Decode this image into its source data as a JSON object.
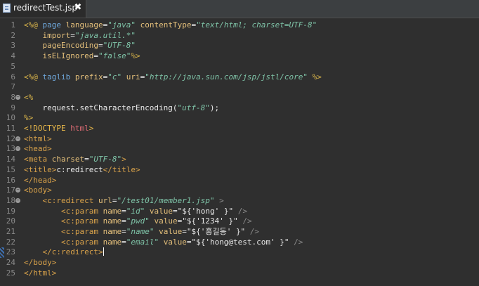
{
  "tab": {
    "title": "redirectTest.jsp",
    "close_glyph": "✖",
    "icon": "jsp-file-icon"
  },
  "gutter": {
    "fold_glyph": "⊖"
  },
  "lines": [
    {
      "n": "1",
      "fold": false,
      "tokens": [
        {
          "t": "<%@ ",
          "c": "t-dir"
        },
        {
          "t": "page ",
          "c": "t-kw"
        },
        {
          "t": "language",
          "c": "t-attr"
        },
        {
          "t": "=",
          "c": "t-plain"
        },
        {
          "t": "\"java\"",
          "c": "t-str"
        },
        {
          "t": " contentType",
          "c": "t-attr"
        },
        {
          "t": "=",
          "c": "t-plain"
        },
        {
          "t": "\"text/html; charset=UTF-8\"",
          "c": "t-str"
        }
      ]
    },
    {
      "n": "2",
      "fold": false,
      "tokens": [
        {
          "t": "    import",
          "c": "t-attr"
        },
        {
          "t": "=",
          "c": "t-plain"
        },
        {
          "t": "\"java.util.*\"",
          "c": "t-str"
        }
      ]
    },
    {
      "n": "3",
      "fold": false,
      "tokens": [
        {
          "t": "    pageEncoding",
          "c": "t-attr"
        },
        {
          "t": "=",
          "c": "t-plain"
        },
        {
          "t": "\"UTF-8\"",
          "c": "t-str"
        }
      ]
    },
    {
      "n": "4",
      "fold": false,
      "tokens": [
        {
          "t": "    isELIgnored",
          "c": "t-attr"
        },
        {
          "t": "=",
          "c": "t-plain"
        },
        {
          "t": "\"false\"",
          "c": "t-str"
        },
        {
          "t": "%>",
          "c": "t-dir"
        }
      ]
    },
    {
      "n": "5",
      "fold": false,
      "tokens": []
    },
    {
      "n": "6",
      "fold": false,
      "tokens": [
        {
          "t": "<%@ ",
          "c": "t-dir"
        },
        {
          "t": "taglib ",
          "c": "t-kw"
        },
        {
          "t": "prefix",
          "c": "t-attr"
        },
        {
          "t": "=",
          "c": "t-plain"
        },
        {
          "t": "\"c\"",
          "c": "t-str"
        },
        {
          "t": " uri",
          "c": "t-attr"
        },
        {
          "t": "=",
          "c": "t-plain"
        },
        {
          "t": "\"http://java.sun.com/jsp/jstl/core\"",
          "c": "t-str"
        },
        {
          "t": " %>",
          "c": "t-dir"
        }
      ]
    },
    {
      "n": "7",
      "fold": false,
      "tokens": []
    },
    {
      "n": "8",
      "fold": true,
      "tokens": [
        {
          "t": "<%",
          "c": "t-dir"
        }
      ]
    },
    {
      "n": "9",
      "fold": false,
      "tokens": [
        {
          "t": "    request.setCharacterEncoding(",
          "c": "t-txt"
        },
        {
          "t": "\"utf-8\"",
          "c": "t-str"
        },
        {
          "t": ");",
          "c": "t-txt"
        }
      ]
    },
    {
      "n": "10",
      "fold": false,
      "tokens": [
        {
          "t": "%>",
          "c": "t-dir"
        }
      ]
    },
    {
      "n": "11",
      "fold": false,
      "tokens": [
        {
          "t": "<!DOCTYPE ",
          "c": "t-doc"
        },
        {
          "t": "html",
          "c": "t-red"
        },
        {
          "t": ">",
          "c": "t-doc"
        }
      ]
    },
    {
      "n": "12",
      "fold": true,
      "tokens": [
        {
          "t": "<html>",
          "c": "t-tag"
        }
      ]
    },
    {
      "n": "13",
      "fold": true,
      "tokens": [
        {
          "t": "<head>",
          "c": "t-tag"
        }
      ]
    },
    {
      "n": "14",
      "fold": false,
      "tokens": [
        {
          "t": "<meta ",
          "c": "t-tag"
        },
        {
          "t": "charset",
          "c": "t-attr"
        },
        {
          "t": "=",
          "c": "t-plain"
        },
        {
          "t": "\"UTF-8\"",
          "c": "t-str"
        },
        {
          "t": ">",
          "c": "t-tag"
        }
      ]
    },
    {
      "n": "15",
      "fold": false,
      "tokens": [
        {
          "t": "<title>",
          "c": "t-tag"
        },
        {
          "t": "c:redirect",
          "c": "t-txt"
        },
        {
          "t": "</title>",
          "c": "t-tag"
        }
      ]
    },
    {
      "n": "16",
      "fold": false,
      "tokens": [
        {
          "t": "</head>",
          "c": "t-tag"
        }
      ]
    },
    {
      "n": "17",
      "fold": true,
      "tokens": [
        {
          "t": "<body>",
          "c": "t-tag"
        }
      ]
    },
    {
      "n": "18",
      "fold": true,
      "tokens": [
        {
          "t": "    <c:redirect ",
          "c": "t-tag"
        },
        {
          "t": "url",
          "c": "t-attr"
        },
        {
          "t": "=",
          "c": "t-plain"
        },
        {
          "t": "\"/test01/member1.jsp\"",
          "c": "t-str"
        },
        {
          "t": " >",
          "c": "t-br"
        }
      ]
    },
    {
      "n": "19",
      "fold": false,
      "tokens": [
        {
          "t": "        <c:param ",
          "c": "t-tag"
        },
        {
          "t": "name",
          "c": "t-attr"
        },
        {
          "t": "=",
          "c": "t-plain"
        },
        {
          "t": "\"id\"",
          "c": "t-str"
        },
        {
          "t": " value",
          "c": "t-attr"
        },
        {
          "t": "=",
          "c": "t-plain"
        },
        {
          "t": "\"${'hong' }\"",
          "c": "t-txt"
        },
        {
          "t": " />",
          "c": "t-br"
        }
      ]
    },
    {
      "n": "20",
      "fold": false,
      "tokens": [
        {
          "t": "        <c:param ",
          "c": "t-tag"
        },
        {
          "t": "name",
          "c": "t-attr"
        },
        {
          "t": "=",
          "c": "t-plain"
        },
        {
          "t": "\"pwd\"",
          "c": "t-str"
        },
        {
          "t": " value",
          "c": "t-attr"
        },
        {
          "t": "=",
          "c": "t-plain"
        },
        {
          "t": "\"${'1234' }\"",
          "c": "t-txt"
        },
        {
          "t": " />",
          "c": "t-br"
        }
      ]
    },
    {
      "n": "21",
      "fold": false,
      "tokens": [
        {
          "t": "        <c:param ",
          "c": "t-tag"
        },
        {
          "t": "name",
          "c": "t-attr"
        },
        {
          "t": "=",
          "c": "t-plain"
        },
        {
          "t": "\"name\"",
          "c": "t-str"
        },
        {
          "t": " value",
          "c": "t-attr"
        },
        {
          "t": "=",
          "c": "t-plain"
        },
        {
          "t": "\"${'홍길동' }\"",
          "c": "t-txt"
        },
        {
          "t": " />",
          "c": "t-br"
        }
      ]
    },
    {
      "n": "22",
      "fold": false,
      "tokens": [
        {
          "t": "        <c:param ",
          "c": "t-tag"
        },
        {
          "t": "name",
          "c": "t-attr"
        },
        {
          "t": "=",
          "c": "t-plain"
        },
        {
          "t": "\"email\"",
          "c": "t-str"
        },
        {
          "t": " value",
          "c": "t-attr"
        },
        {
          "t": "=",
          "c": "t-plain"
        },
        {
          "t": "\"${'hong@test.com' }\"",
          "c": "t-txt"
        },
        {
          "t": " />",
          "c": "t-br"
        }
      ]
    },
    {
      "n": "23",
      "fold": false,
      "current": true,
      "tokens": [
        {
          "t": "    </c:redirect>",
          "c": "t-tag"
        }
      ]
    },
    {
      "n": "24",
      "fold": false,
      "tokens": [
        {
          "t": "</body>",
          "c": "t-tag"
        }
      ]
    },
    {
      "n": "25",
      "fold": false,
      "tokens": [
        {
          "t": "</html>",
          "c": "t-tag"
        }
      ]
    }
  ]
}
